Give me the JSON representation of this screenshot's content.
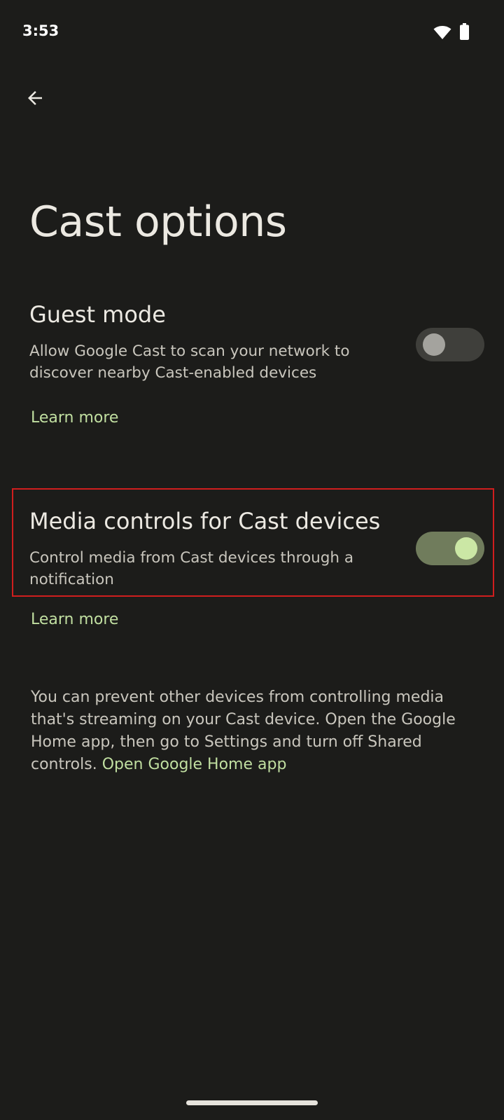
{
  "status_bar": {
    "time": "3:53",
    "icons": [
      "wifi-icon",
      "battery-icon"
    ]
  },
  "toolbar": {
    "back_icon": "arrow-back-icon"
  },
  "page": {
    "title": "Cast options"
  },
  "settings": [
    {
      "title": "Guest mode",
      "summary": "Allow Google Cast to scan your network to discover nearby Cast-enabled devices",
      "switch_state": "off",
      "link": "Learn more"
    },
    {
      "title": "Media controls for Cast devices",
      "summary": "Control media from Cast devices through a notification",
      "switch_state": "on",
      "link": "Learn more"
    }
  ],
  "footer": {
    "text": "You can prevent other devices from controlling media that's streaming on your Cast device. Open the Google Home app, then go to Settings and turn off Shared controls.",
    "link": "Open Google Home app"
  },
  "colors": {
    "background": "#1c1c1a",
    "accent_link": "#c1dfa1",
    "switch_on_track": "#707c5c",
    "switch_on_thumb": "#cbe7a5",
    "highlight_border": "#d01e1e"
  }
}
